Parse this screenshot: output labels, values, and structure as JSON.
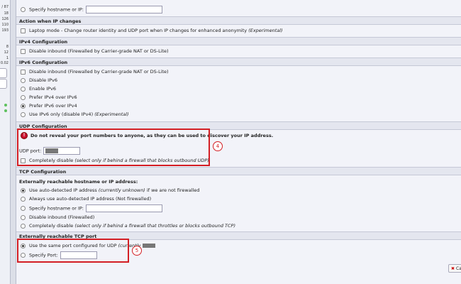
{
  "sidebar": {
    "numbers": [
      "/ 87",
      "18",
      "126",
      "110",
      "193",
      "8",
      "12",
      "1",
      "0.02"
    ]
  },
  "top_row": {
    "label": "Specify hostname or IP:"
  },
  "action_ip": {
    "title": "Action when IP changes",
    "laptop_label": "Laptop mode - Change router identity and UDP port when IP changes for enhanced anonymity",
    "laptop_suffix": "(Experimental)"
  },
  "ipv4": {
    "title": "IPv4 Configuration",
    "disable_inbound": "Disable inbound (Firewalled by Carrier-grade NAT or DS-Lite)"
  },
  "ipv6": {
    "title": "IPv6 Configuration",
    "options": [
      "Disable inbound (Firewalled by Carrier-grade NAT or DS-Lite)",
      "Disable IPv6",
      "Enable IPv6",
      "Prefer IPv4 over IPv6",
      "Prefer IPv6 over IPv4",
      "Use IPv6 only (disable IPv4)"
    ],
    "ipv6only_suffix": "(Experimental)"
  },
  "udp": {
    "title": "UDP Configuration",
    "warning": "Do not reveal your port numbers to anyone, as they can be used to discover your IP address.",
    "port_label": "UDP port:",
    "disable_label": "Completely disable",
    "disable_note": "(select only if behind a firewall that blocks outbound UDP)",
    "annotation": "4"
  },
  "tcp": {
    "title": "TCP Configuration",
    "hostname_header": "Externally reachable hostname or IP address:",
    "autodetect_label": "Use auto-detected IP address",
    "autodetect_note": "(currently unknown)",
    "autodetect_suffix": "if we are not firewalled",
    "always_label": "Always use auto-detected IP address (Not firewalled)",
    "specify_label": "Specify hostname or IP:",
    "disable_inbound": "Disable inbound (Firewalled)",
    "completely_disable": "Completely disable",
    "completely_note": "(select only if behind a firewall that throttles or blocks outbound TCP)"
  },
  "tcp_port": {
    "title": "Externally reachable TCP port",
    "same_port_label": "Use the same port configured for UDP",
    "same_port_note": "(currently",
    "specify_port_label": "Specify Port:",
    "annotation": "5"
  },
  "cancel_label": "Ca"
}
